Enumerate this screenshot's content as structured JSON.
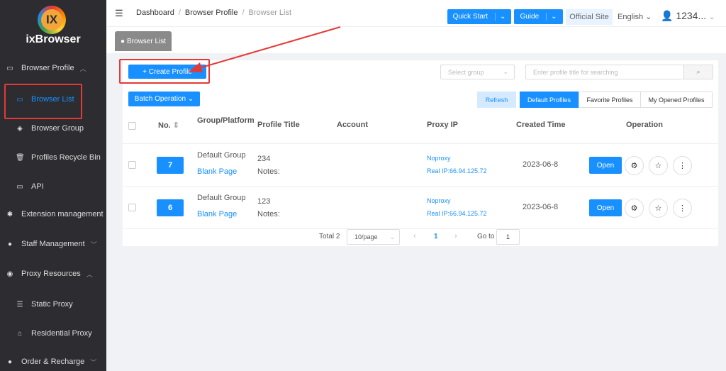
{
  "sidebar": {
    "brand": "ixBrowser",
    "logo_text": "IX",
    "items": [
      {
        "label": "Browser Profile",
        "icon": "window-icon",
        "chevron": "up"
      },
      {
        "label": "Browser List",
        "icon": "window-icon"
      },
      {
        "label": "Browser Group",
        "icon": "cube-icon"
      },
      {
        "label": "Profiles Recycle Bin",
        "icon": "trash-icon"
      },
      {
        "label": "API",
        "icon": "window-icon"
      },
      {
        "label": "Extension management",
        "icon": "puzzle-icon"
      },
      {
        "label": "Staff Management",
        "icon": "user-icon",
        "chevron": "down"
      },
      {
        "label": "Proxy Resources",
        "icon": "globe-icon",
        "chevron": "up"
      },
      {
        "label": "Static Proxy",
        "icon": "list-icon"
      },
      {
        "label": "Residential Proxy",
        "icon": "house-icon"
      },
      {
        "label": "Order & Recharge",
        "icon": "coin-icon",
        "chevron": "down"
      }
    ]
  },
  "header": {
    "breadcrumb": [
      "Dashboard",
      "Browser Profile",
      "Browser List"
    ],
    "quick_start": "Quick Start",
    "guide": "Guide",
    "official_site": "Official Site",
    "language": "English",
    "user": "1234..."
  },
  "tab": "Browser List",
  "toolbar": {
    "create_profile": "+ Create Profile",
    "select_group_placeholder": "Select group",
    "search_placeholder": "Enter profile title for searching",
    "batch_operation": "Batch Operation",
    "refresh": "Refresh",
    "filters": [
      "Default Profiles",
      "Favorite Profiles",
      "My Opened Profiles"
    ]
  },
  "table": {
    "headers": [
      "No.",
      "Group/Platform",
      "Profile Title",
      "Account",
      "Proxy IP",
      "Created Time",
      "Operation"
    ],
    "rows": [
      {
        "no": "7",
        "group": "Default Group",
        "platform": "Blank Page",
        "title": "234",
        "notes": "Notes:",
        "proxy": "Noproxy",
        "real_ip": "Real IP:66.94.125.72",
        "created": "2023-06-8",
        "open": "Open"
      },
      {
        "no": "6",
        "group": "Default Group",
        "platform": "Blank Page",
        "title": "123",
        "notes": "Notes:",
        "proxy": "Noproxy",
        "real_ip": "Real IP:66.94.125.72",
        "created": "2023-06-8",
        "open": "Open"
      }
    ]
  },
  "pagination": {
    "total": "Total 2",
    "page_size": "10/page",
    "current": "1",
    "goto_label": "Go to",
    "goto_value": "1"
  },
  "colors": {
    "primary": "#1890ff",
    "sidebar": "#2d2d31",
    "highlight": "#e53935"
  }
}
